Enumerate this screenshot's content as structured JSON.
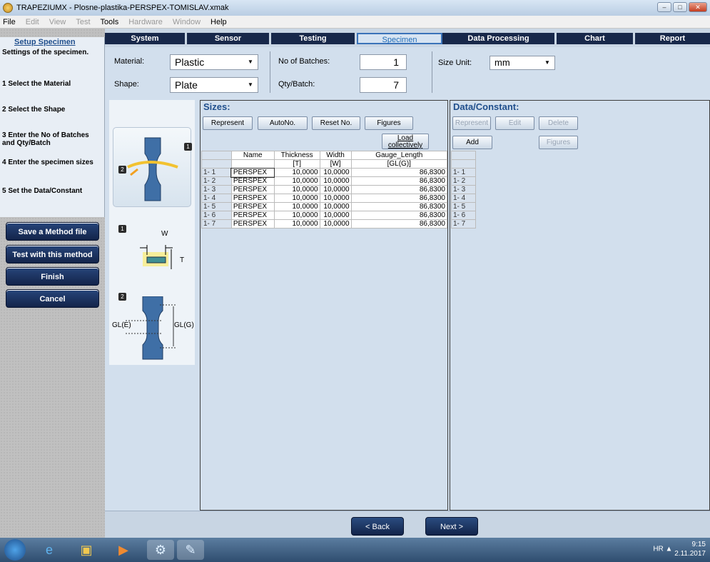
{
  "window": {
    "title": "TRAPEZIUMX - Plosne-plastika-PERSPEX-TOMISLAV.xmak"
  },
  "menu": [
    "File",
    "Edit",
    "View",
    "Test",
    "Tools",
    "Hardware",
    "Window",
    "Help"
  ],
  "tabs": [
    "System",
    "Sensor",
    "Testing",
    "Specimen",
    "Data Processing",
    "Chart",
    "Report"
  ],
  "left": {
    "title": "Setup Specimen",
    "subtitle": "Settings of the specimen.",
    "steps": [
      "1  Select the Material",
      "2  Select the Shape",
      "3  Enter the No of Batches and Qty/Batch",
      "4  Enter the specimen sizes",
      "5  Set the Data/Constant"
    ],
    "buttons": [
      "Save a Method file",
      "Test with this method",
      "Finish",
      "Cancel"
    ]
  },
  "form": {
    "material_label": "Material:",
    "material_value": "Plastic",
    "shape_label": "Shape:",
    "shape_value": "Plate",
    "batches_label": "No of Batches:",
    "batches_value": "1",
    "qty_label": "Qty/Batch:",
    "qty_value": "7",
    "size_unit_label": "Size Unit:",
    "size_unit_value": "mm"
  },
  "illustration": {
    "step1": "1",
    "step2": "2",
    "w": "W",
    "t": "T",
    "gle": "GL(E)",
    "glg": "GL(G)"
  },
  "sizes": {
    "title": "Sizes:",
    "buttons": {
      "represent": "Represent",
      "autono": "AutoNo.",
      "resetno": "Reset No.",
      "figures": "Figures",
      "load": "Load collectively"
    },
    "columns": [
      "Name",
      "Thickness",
      "Width",
      "Gauge_Length"
    ],
    "units": [
      "",
      "[T]",
      "[W]",
      "[GL(G)]"
    ],
    "rows": [
      {
        "id": "1- 1",
        "name": "PERSPEX",
        "thickness": "10,0000",
        "width": "10,0000",
        "gauge": "86,8300"
      },
      {
        "id": "1- 2",
        "name": "PERSPEX",
        "thickness": "10,0000",
        "width": "10,0000",
        "gauge": "86,8300"
      },
      {
        "id": "1- 3",
        "name": "PERSPEX",
        "thickness": "10,0000",
        "width": "10,0000",
        "gauge": "86,8300"
      },
      {
        "id": "1- 4",
        "name": "PERSPEX",
        "thickness": "10,0000",
        "width": "10,0000",
        "gauge": "86,8300"
      },
      {
        "id": "1- 5",
        "name": "PERSPEX",
        "thickness": "10,0000",
        "width": "10,0000",
        "gauge": "86,8300"
      },
      {
        "id": "1- 6",
        "name": "PERSPEX",
        "thickness": "10,0000",
        "width": "10,0000",
        "gauge": "86,8300"
      },
      {
        "id": "1- 7",
        "name": "PERSPEX",
        "thickness": "10,0000",
        "width": "10,0000",
        "gauge": "86,8300"
      }
    ]
  },
  "datacon": {
    "title": "Data/Constant:",
    "buttons": {
      "represent": "Represent",
      "edit": "Edit",
      "delete": "Delete",
      "add": "Add",
      "figures": "Figures"
    },
    "rows": [
      "1- 1",
      "1- 2",
      "1- 3",
      "1- 4",
      "1- 5",
      "1- 6",
      "1- 7"
    ]
  },
  "nav": {
    "back": "< Back",
    "next": "Next >"
  },
  "tray": {
    "lang": "HR",
    "time": "9:15",
    "date": "2.11.2017"
  },
  "colors": {
    "accent": "#1f4e8c",
    "button_dark": "#13244a",
    "panel": "#d2dfed"
  }
}
